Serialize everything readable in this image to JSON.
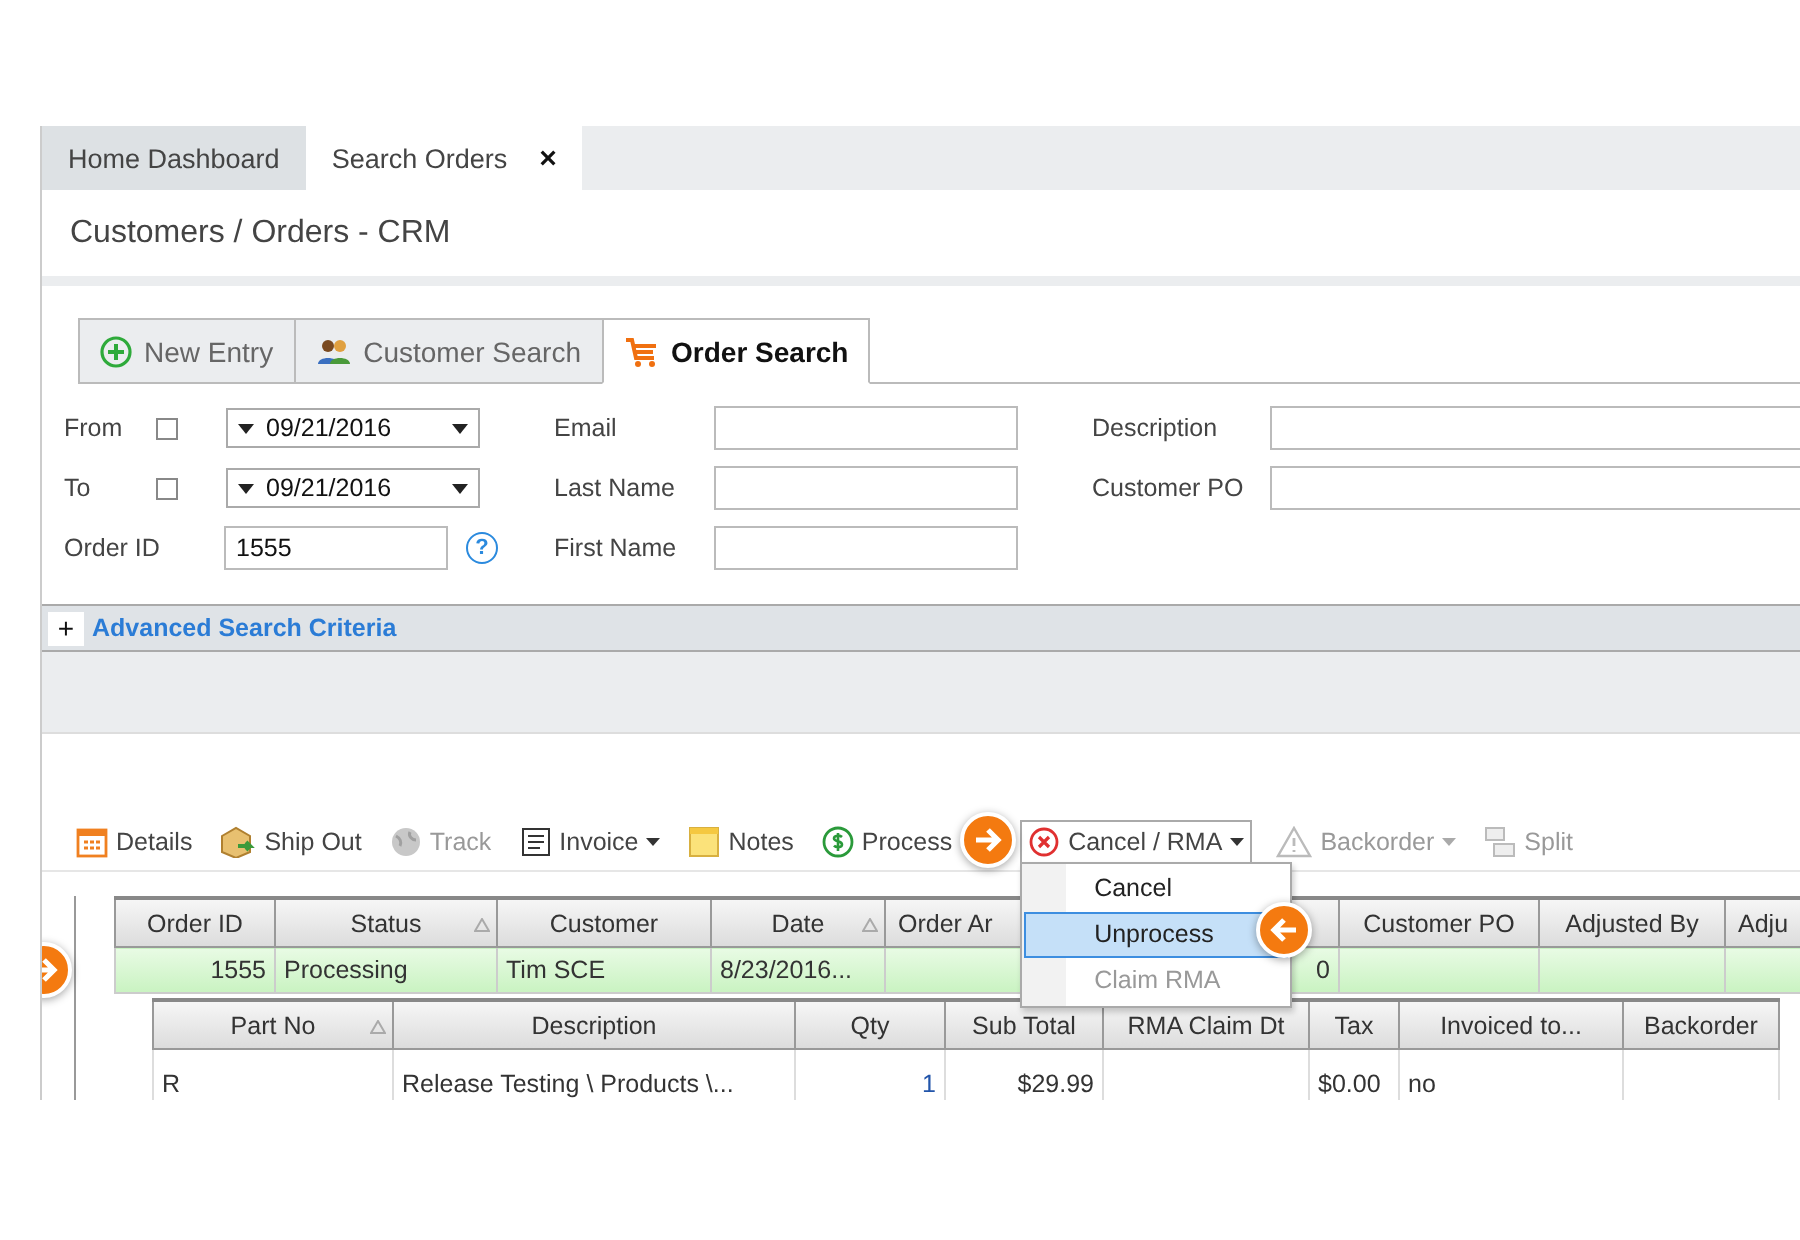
{
  "app_tabs": [
    {
      "label": "Home Dashboard",
      "selected": false
    },
    {
      "label": "Search Orders",
      "selected": true,
      "close_glyph": "×"
    }
  ],
  "page_title": "Customers / Orders - CRM",
  "search_tabs": [
    {
      "label": "New Entry",
      "kind": "plus",
      "selected": false
    },
    {
      "label": "Customer Search",
      "kind": "people",
      "selected": false
    },
    {
      "label": "Order Search",
      "kind": "cart",
      "selected": true
    }
  ],
  "date_filters": [
    {
      "label": "From",
      "checked": false,
      "date": "09/21/2016"
    },
    {
      "label": "To",
      "checked": false,
      "date": "09/21/2016"
    }
  ],
  "order_id": {
    "label": "Order ID",
    "value": "1555",
    "help_glyph": "?"
  },
  "name_fields": [
    {
      "label": "Email"
    },
    {
      "label": "Last Name"
    },
    {
      "label": "First Name"
    }
  ],
  "other_fields": [
    {
      "label": "Description"
    },
    {
      "label": "Customer PO"
    }
  ],
  "advanced": {
    "toggle": "+",
    "label": "Advanced Search Criteria"
  },
  "toolbar": [
    {
      "label": "Details",
      "kind": "calendar",
      "disabled": false,
      "dropdown": false,
      "open": false
    },
    {
      "label": "Ship Out",
      "kind": "box",
      "disabled": false,
      "dropdown": false,
      "open": false
    },
    {
      "label": "Track",
      "kind": "globe",
      "disabled": true,
      "dropdown": false,
      "open": false
    },
    {
      "label": "Invoice",
      "kind": "document",
      "disabled": false,
      "dropdown": true,
      "open": false
    },
    {
      "label": "Notes",
      "kind": "note",
      "disabled": false,
      "dropdown": false,
      "open": false
    },
    {
      "label": "Process",
      "kind": "money",
      "disabled": false,
      "dropdown": false,
      "open": false
    },
    {
      "label": "Cancel / RMA",
      "kind": "cancel",
      "disabled": false,
      "dropdown": true,
      "open": true
    },
    {
      "label": "Backorder",
      "kind": "warning",
      "disabled": true,
      "dropdown": true,
      "open": false
    },
    {
      "label": "Split",
      "kind": "split",
      "disabled": true,
      "dropdown": false,
      "open": false
    }
  ],
  "cancel_menu": [
    {
      "label": "Cancel",
      "selected": false,
      "disabled": false
    },
    {
      "label": "Unprocess",
      "selected": true,
      "disabled": false
    },
    {
      "label": "Claim RMA",
      "selected": false,
      "disabled": true
    }
  ],
  "orders_table": {
    "columns": [
      {
        "label": "Order ID",
        "sortable": false
      },
      {
        "label": "Status",
        "sortable": true
      },
      {
        "label": "Customer",
        "sortable": false
      },
      {
        "label": "Date",
        "sortable": true
      },
      {
        "label": "Order Ar"
      },
      {},
      {
        "label": "Customer PO",
        "sortable": false
      },
      {
        "label": "Adjusted By",
        "sortable": false
      },
      {
        "label": "Adju"
      }
    ],
    "rows": [
      {
        "selected": true,
        "cells": [
          "1555",
          "Processing",
          "Tim SCE",
          "8/23/2016...",
          "",
          "0",
          "",
          "",
          ""
        ]
      }
    ]
  },
  "details_table": {
    "columns": [
      {
        "label": "Part No",
        "sortable": true
      },
      {
        "label": "Description",
        "sortable": false
      },
      {
        "label": "Qty",
        "sortable": false
      },
      {
        "label": "Sub Total",
        "sortable": false
      },
      {
        "label": "RMA Claim Dt",
        "sortable": false
      },
      {
        "label": "Tax",
        "sortable": false
      },
      {
        "label": "Invoiced  to...",
        "sortable": false
      },
      {
        "label": "Backorder",
        "sortable": false
      }
    ],
    "rows": [
      {
        "cells": [
          "R",
          "Release Testing \\ Products \\...",
          "1",
          "$29.99",
          "",
          "$0.00",
          "no",
          ""
        ]
      }
    ]
  }
}
